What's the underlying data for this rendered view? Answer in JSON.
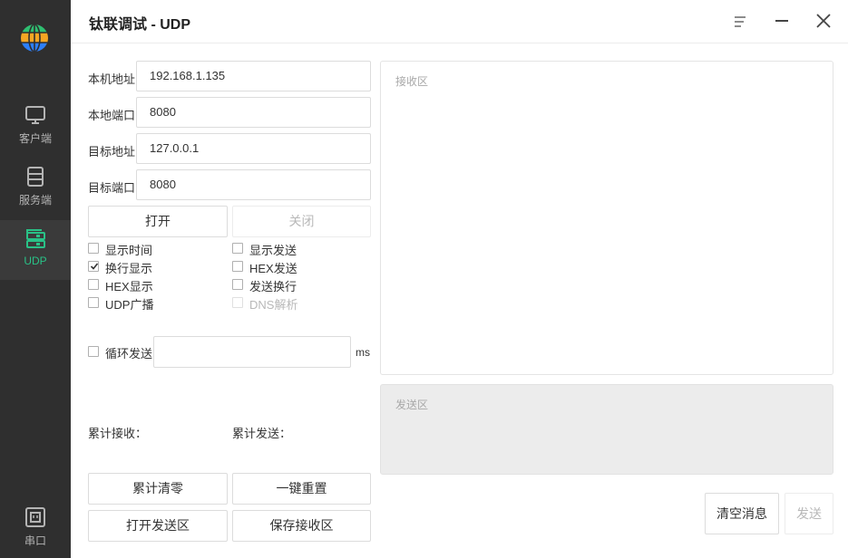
{
  "app": {
    "title": "钛联调试 - UDP"
  },
  "sidebar": {
    "items": [
      {
        "label": "客户端",
        "icon": "monitor-icon"
      },
      {
        "label": "服务端",
        "icon": "server-icon"
      },
      {
        "label": "UDP",
        "icon": "udp-icon",
        "active": true
      },
      {
        "label": "串口",
        "icon": "serial-port-icon"
      }
    ]
  },
  "form": {
    "local_address_label": "本机地址",
    "local_address_value": "192.168.1.135",
    "local_port_label": "本地端口",
    "local_port_value": "8080",
    "target_address_label": "目标地址",
    "target_address_value": "127.0.0.1",
    "target_port_label": "目标端口",
    "target_port_value": "8080"
  },
  "buttons": {
    "open": "打开",
    "close": "关闭",
    "reset_counters": "累计清零",
    "one_key_reset": "一键重置",
    "open_send_area": "打开发送区",
    "save_recv_area": "保存接收区",
    "clear_messages": "清空消息",
    "send": "发送"
  },
  "options": [
    {
      "label": "显示时间",
      "checked": false
    },
    {
      "label": "显示发送",
      "checked": false
    },
    {
      "label": "换行显示",
      "checked": true
    },
    {
      "label": "HEX发送",
      "checked": false
    },
    {
      "label": "HEX显示",
      "checked": false
    },
    {
      "label": "发送换行",
      "checked": false
    },
    {
      "label": "UDP广播",
      "checked": false
    },
    {
      "label": "DNS解析",
      "checked": false,
      "disabled": true
    }
  ],
  "loop_send": {
    "label": "循环发送",
    "value": "",
    "unit": "ms"
  },
  "stats": {
    "received_label": "累计接收：",
    "sent_label": "累计发送："
  },
  "areas": {
    "receive_placeholder": "接收区",
    "send_placeholder": "发送区"
  },
  "colors": {
    "accent": "#29c287",
    "sidebar_bg": "#2f2f2f",
    "sidebar_active_bg": "#3a3a3a"
  }
}
